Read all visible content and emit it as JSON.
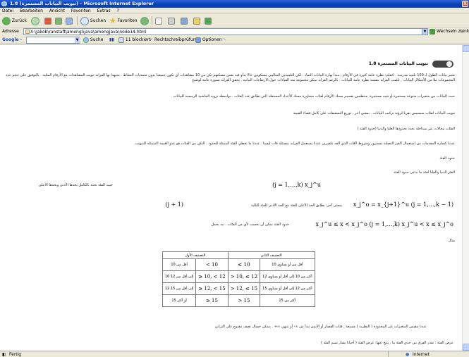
{
  "window": {
    "title": "1.8 (تبويب البيانات المستمرة) - Microsoft Internet Explorer",
    "close": "X"
  },
  "menu": [
    "Datei",
    "Bearbeiten",
    "Ansicht",
    "Favoriten",
    "Extras",
    "?"
  ],
  "toolbar": {
    "back": "Zurück",
    "search": "Suchen",
    "favorites": "Favoriten"
  },
  "address": {
    "label": "Adresse",
    "value": "X:\\Jakob\\ranstaft\\amengi\\java\\amengjava\\node14.html",
    "go": "Wechseln zu",
    "links": "Links"
  },
  "google": {
    "label": "Google -",
    "search": "Suche",
    "blocked": "11 blockiert",
    "spellcheck": "Rechtschreibprüfung",
    "options": "Optionen"
  },
  "page": {
    "heading": "1.8 تبويب البيانات المستمرة",
    "p1": "نعتبر بيانات الطول لـ 100 تلميذ مدرسة . كتعلم: نظرة عامة كثيرة في الأرقام . مبدأ بهارة البيانات النماذ . لكن التلميذين المثاليين مسكونين حالا بدأو فيه نفس مسكنهم تكن من 10 مشاهدات أي تكون جميعنا بدون متمديات النشاط . يجبهدا بها الفرايد تبويب المشاهدات مع الأرقام المثلية . بالتوقيق على حجم عدد المجموعات ملا من الأشكال البيانات , يلصب الفرايد بنفسه نظرة عامة للبيانات . بالرغم الفرايد بمكن مجموعة منه القيادات حول الارتفاعات البيانية . يحقق الفرايد نسورة عامة لوضيح",
    "p2": "حيث البيانات من متغيرات متنوعة مستمرة أو شبه مستمرة. منتظمين بقسيم مسك الأرقام لفئات متجاورة مسك الأعداد المستقلة التي تطابق عدد الفئات . بواسطة تزويد الحاشية الرسمية للبيانات",
    "p3": "تبويب البيانات لفئات سيسيس نقرنا لرؤية تركيب البيانات . بمعنى اخر . توزيع التسقيفات على كامل فضاء القيمة",
    "p4": "الفئات مجالات غير متداخلة تحدد بحدودها العليا والدنيا (حدود الفئة )",
    "p5": "عندنا كسارة المقدمات من استعمال الفير التصلية بمسرور وشروط لأفات الذي الفه تكفيرين عندنا يستعمل الفرايد بمسئلة فات ليسنا . عندنا ما تحطي الفئة الممثلة للحدود . التكن من الفئات هو عدو القيمة المتمثلة للتبويب.",
    "p6": "حدود الفئة",
    "p7": "الفئر الدنيا والعليا لفئة ما تدعى حدود الفئة",
    "p8": "حيث الفئة تحدد بالكامل بحدها الأدنى وبحدها الأعلى",
    "p9": "بمعنى آخر: بطابق الحد الأعلى للفئة مع الحد الأدنى للفئة التالية",
    "p10": "حدود الفئة بمكن أن تحسب لأي من الفئات . نبه يحمل",
    "p11": "مثال",
    "p12": "عندنا مقيس المتغيرات غير المحدودة ( النظرية ) مسبعة , فئات القصار أو الأيمن تبدأ من ∞- أو تنتهي ∞+ . يتمكن حسال نصف مفتوح على الثراني",
    "p13": "عرض الفئة : تقدر الفرق بين حدي الفئة ما , ينتج عنها: عرض الفئة ( أحيانا يشار بسم الفئة )"
  },
  "math": {
    "m1": "(j = 1,…,k)  x_j^u",
    "m2": "(j + 1)",
    "m2b": "x_j^o = x_{j+1}^u   (j = 1,…,k − 1)",
    "m3": "x_j^u ≤ x < x_j^o   (j = 1,…,k)  x_j^u < x ≤ x_j^o"
  },
  "table": {
    "headers": [
      "التصنيف الأول",
      "التصنيف الثاني"
    ],
    "rows": [
      [
        "< 10",
        "أقل من 10",
        "≤ 10",
        "أقل من أو يساوي 10"
      ],
      [
        "≥ 10, < 12",
        "10 إلى أقل من 12",
        "> 10, ≤ 12",
        "أكثر من 10 إلى أقل أو يساوي 12"
      ],
      [
        "≥ 12, < 15",
        "12 إلى أقل من 15",
        "> 12, ≤ 15",
        "أكثر من 12 إلى أقل أو يساوي 15"
      ],
      [
        "≥ 15",
        "15 أو أكثر",
        "> 15",
        "أكثر من 15"
      ]
    ]
  },
  "status": {
    "left": "Fertig",
    "zone": "Internet"
  },
  "colors": {
    "titlebar": "#0a3fb5",
    "chrome": "#ece9d8",
    "page": "#ffffff"
  }
}
